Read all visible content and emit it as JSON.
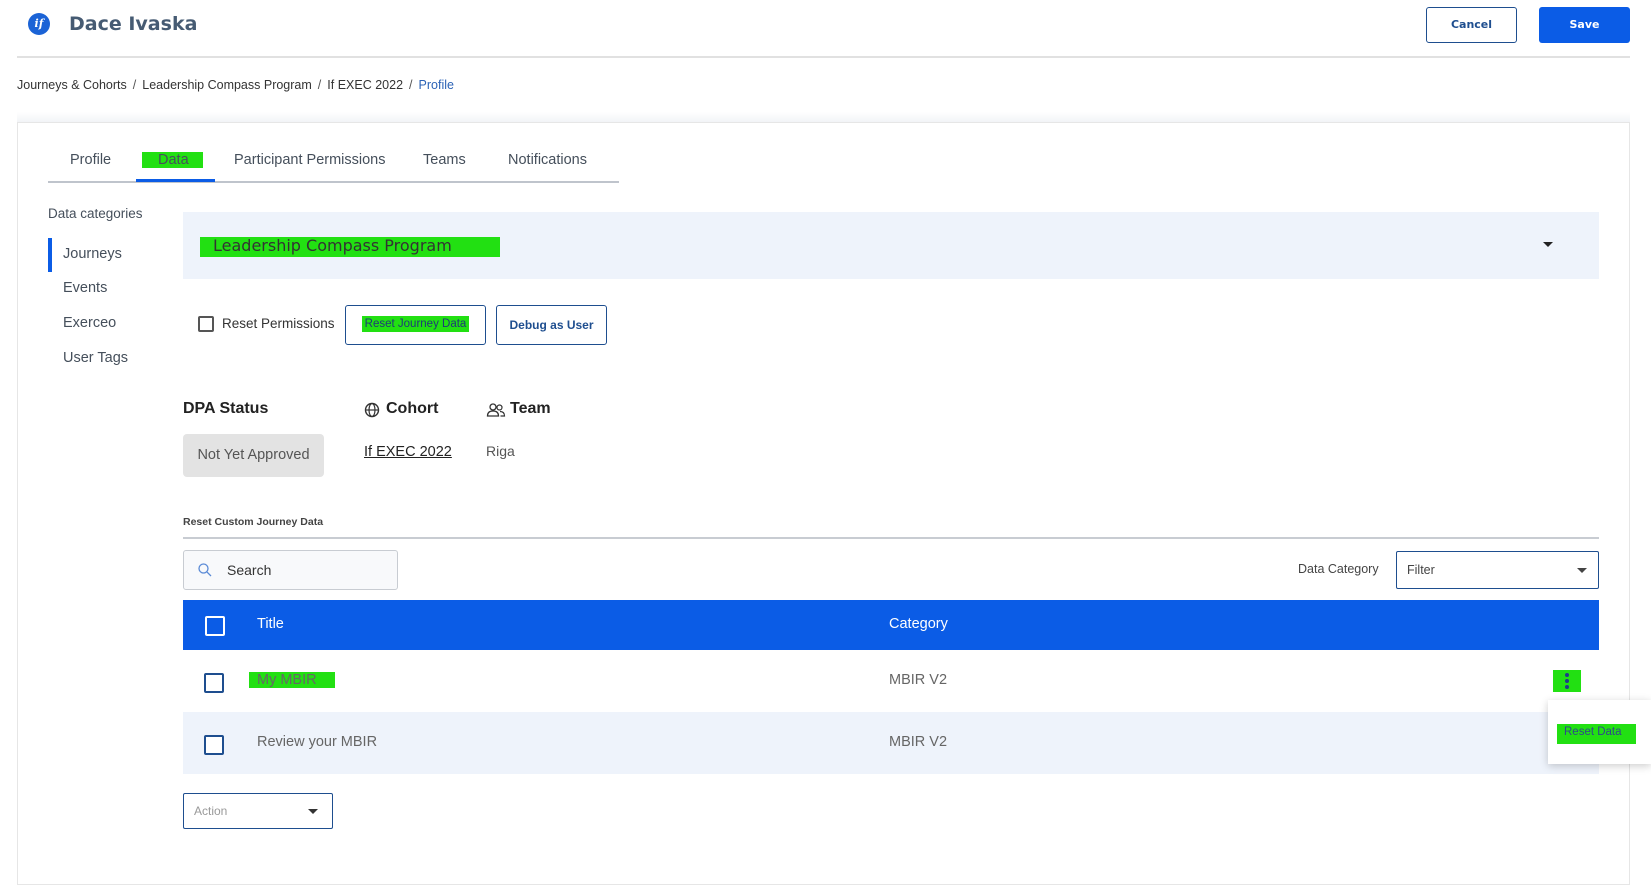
{
  "header": {
    "logo_text": "if",
    "user_name": "Dace Ivaska",
    "cancel_label": "Cancel",
    "save_label": "Save"
  },
  "breadcrumb": {
    "items": [
      "Journeys & Cohorts",
      "Leadership Compass Program",
      "If EXEC 2022"
    ],
    "current": "Profile",
    "separator": "/"
  },
  "tabs": [
    "Profile",
    "Data",
    "Participant Permissions",
    "Teams",
    "Notifications"
  ],
  "active_tab": "Data",
  "sidebar": {
    "title": "Data categories",
    "items": [
      "Journeys",
      "Events",
      "Exerceo",
      "User Tags"
    ],
    "active": "Journeys"
  },
  "program_select": {
    "value": "Leadership Compass Program"
  },
  "actions": {
    "reset_permissions_label": "Reset Permissions",
    "reset_journey_label": "Reset Journey Data",
    "debug_label": "Debug as User"
  },
  "status": {
    "dpa_title": "DPA Status",
    "dpa_value": "Not Yet Approved",
    "cohort_title": "Cohort",
    "cohort_value": "If EXEC 2022",
    "team_title": "Team",
    "team_value": "Riga"
  },
  "custom_data": {
    "section_title": "Reset Custom Journey Data",
    "search_placeholder": "Search",
    "data_category_label": "Data Category",
    "filter_value": "Filter",
    "columns": [
      "Title",
      "Category"
    ],
    "rows": [
      {
        "title": "My MBIR",
        "category": "MBIR V2"
      },
      {
        "title": "Review your MBIR",
        "category": "MBIR V2"
      }
    ],
    "row_menu_item": "Reset Data",
    "action_placeholder": "Action"
  },
  "colors": {
    "primary": "#0b5ce6",
    "highlight": "#22e012",
    "row_alt": "#eef3fb"
  }
}
